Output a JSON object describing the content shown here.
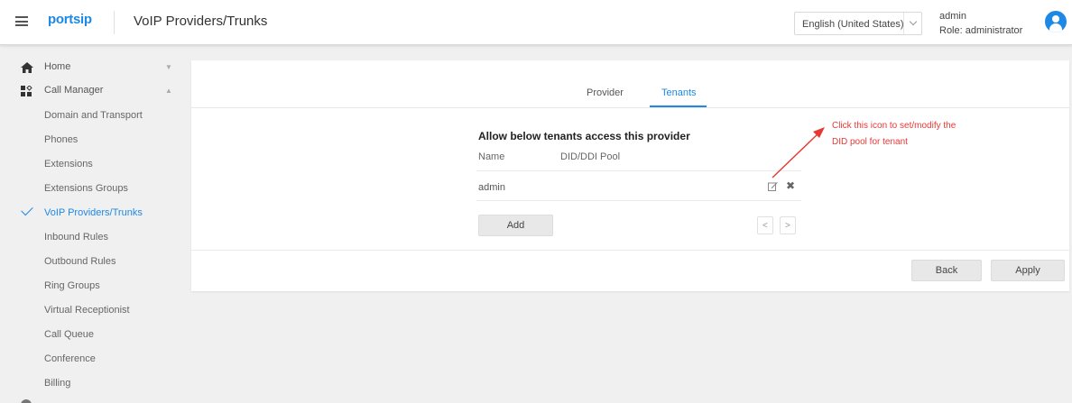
{
  "header": {
    "logo": "portsip",
    "title": "VoIP Providers/Trunks",
    "language": "English (United States)",
    "user_name": "admin",
    "user_role": "Role: administrator"
  },
  "sidebar": {
    "top_items": [
      {
        "label": "Home",
        "icon": "home-icon",
        "caret": "▼"
      },
      {
        "label": "Call Manager",
        "icon": "call-manager-icon",
        "caret": "▲"
      }
    ],
    "items": [
      {
        "label": "Domain and Transport"
      },
      {
        "label": "Phones"
      },
      {
        "label": "Extensions"
      },
      {
        "label": "Extensions Groups"
      },
      {
        "label": "VoIP Providers/Trunks",
        "active": true
      },
      {
        "label": "Inbound Rules"
      },
      {
        "label": "Outbound Rules"
      },
      {
        "label": "Ring Groups"
      },
      {
        "label": "Virtual Receptionist"
      },
      {
        "label": "Call Queue"
      },
      {
        "label": "Conference"
      },
      {
        "label": "Billing"
      }
    ]
  },
  "tabs": [
    {
      "label": "Provider",
      "active": false
    },
    {
      "label": "Tenants",
      "active": true
    }
  ],
  "tenants": {
    "section_title": "Allow below tenants access this provider",
    "columns": [
      "Name",
      "DID/DDI Pool"
    ],
    "rows": [
      {
        "name": "admin",
        "did_pool": ""
      }
    ],
    "add_label": "Add",
    "prev_glyph": "<",
    "next_glyph": ">"
  },
  "footer": {
    "back_label": "Back",
    "apply_label": "Apply"
  },
  "annotation": {
    "line1": "Click this icon to set/modify the",
    "line2": "DID pool for tenant",
    "color": "#e53935"
  },
  "colors": {
    "accent": "#1e88e5"
  }
}
